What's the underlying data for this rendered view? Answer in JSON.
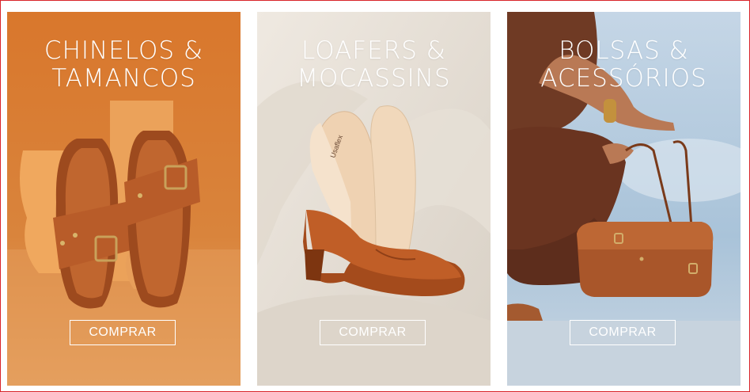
{
  "cards": [
    {
      "title_line1": "CHINELOS &",
      "title_line2": "TAMANCOS",
      "button_label": "COMPRAR",
      "accent": "#d7792f"
    },
    {
      "title_line1": "LOAFERS &",
      "title_line2": "MOCASSINS",
      "button_label": "COMPRAR",
      "accent": "#e4ddd3"
    },
    {
      "title_line1": "BOLSAS &",
      "title_line2": "ACESSÓRIOS",
      "button_label": "COMPRAR",
      "accent": "#a7c2d8"
    }
  ],
  "insole_brand": "Usaflex"
}
